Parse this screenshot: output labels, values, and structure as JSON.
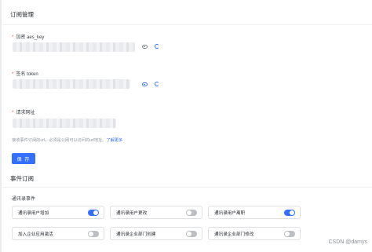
{
  "subscription_section": {
    "title": "订阅管理"
  },
  "fields": {
    "aes_key": {
      "label": "加密 aes_key"
    },
    "token": {
      "label": "签名 token"
    },
    "request_url": {
      "label": "请求网址"
    }
  },
  "request_hint": {
    "text": "接收事件订阅的url，必须是公网可以访问的url地址。",
    "link": "了解更多"
  },
  "save_button": {
    "label": "保 存"
  },
  "event_section": {
    "title": "事件订阅"
  },
  "event_group": {
    "label": "通讯录事件"
  },
  "events": [
    {
      "label": "通讯录用户增加",
      "enabled": true
    },
    {
      "label": "通讯录用户更改",
      "enabled": false
    },
    {
      "label": "通讯录用户离职",
      "enabled": true
    },
    {
      "label": "加入企业应用激活",
      "enabled": false
    },
    {
      "label": "通讯录企业部门创建",
      "enabled": false
    },
    {
      "label": "通讯录企业部门修改",
      "enabled": false
    }
  ],
  "watermark": {
    "text": "CSDN @damys"
  },
  "colors": {
    "accent": "#3370ff",
    "required": "#f54a45",
    "toggle_off": "#bbbfc4"
  },
  "icons": {
    "visibility": "eye-icon",
    "regenerate": "refresh-icon"
  }
}
